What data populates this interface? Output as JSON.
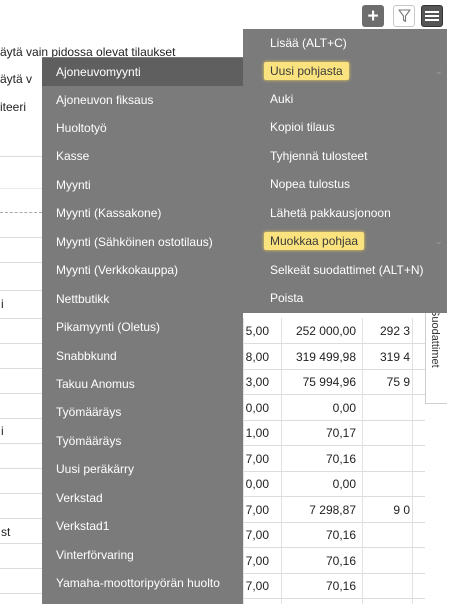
{
  "toolbar": {
    "add_glyph": "+",
    "filter_icon": "filter-icon",
    "menu_icon": "hamburger-menu-icon"
  },
  "background": {
    "top_lines": [
      "äytä vain pidossa olevat tilaukset",
      "äytä v",
      "iteeri"
    ],
    "side_column_values": [
      "i",
      "i",
      "st"
    ],
    "filter_tab_label": "Suodattimet",
    "table_rows": [
      {
        "c1": "5,00",
        "c2": "252 000,00",
        "c3": "292 3"
      },
      {
        "c1": "8,00",
        "c2": "319 499,98",
        "c3": "319 4"
      },
      {
        "c1": "3,00",
        "c2": "75 994,96",
        "c3": "75 9"
      },
      {
        "c1": "0,00",
        "c2": "0,00",
        "c3": ""
      },
      {
        "c1": "1,00",
        "c2": "70,17",
        "c3": ""
      },
      {
        "c1": "7,00",
        "c2": "70,16",
        "c3": ""
      },
      {
        "c1": "0,00",
        "c2": "0,00",
        "c3": ""
      },
      {
        "c1": "7,00",
        "c2": "7 298,87",
        "c3": "9 0"
      },
      {
        "c1": "7,00",
        "c2": "70,16",
        "c3": ""
      },
      {
        "c1": "7,00",
        "c2": "70,16",
        "c3": ""
      },
      {
        "c1": "7,00",
        "c2": "70,16",
        "c3": ""
      }
    ]
  },
  "templates_menu": {
    "items": [
      "Ajoneuvomyynti",
      "Ajoneuvon fiksaus",
      "Huoltotyö",
      "Kasse",
      "Myynti",
      "Myynti (Kassakone)",
      "Myynti (Sähköinen ostotilaus)",
      "Myynti (Verkkokauppa)",
      "Nettbutikk",
      "Pikamyynti (Oletus)",
      "Snabbkund",
      "Takuu Anomus",
      "Työmääräys",
      "Työmääräys",
      "Uusi peräkärry",
      "Verkstad",
      "Verkstad1",
      "Vinterförvaring",
      "Yamaha-moottoripyörän huolto"
    ],
    "hovered_index": 0
  },
  "actions_menu": {
    "items": [
      "Lisää (ALT+C)",
      "Uusi pohjasta",
      "Auki",
      "Kopioi tilaus",
      "Tyhjennä tulosteet",
      "Nopea tulostus",
      "Lähetä pakkausjonoon",
      "Muokkaa pohjaa",
      "Selkeät suodattimet (ALT+N)",
      "Poista"
    ],
    "highlighted_indices": [
      1,
      7
    ],
    "highlight_color": "#fae27e",
    "menu_bg_color": "#7b7b7b",
    "hover_bg_color": "#5f5f5f"
  }
}
